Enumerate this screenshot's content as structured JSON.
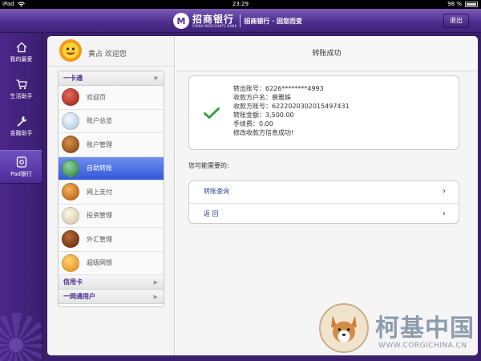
{
  "statusbar": {
    "device": "iPad",
    "time": "23:29",
    "battery": "98 %"
  },
  "header": {
    "logo_mark": "M",
    "brand_cn": "招商银行",
    "brand_en": "CHINA MERCHANTS BANK",
    "slogan": "招商银行 · 因您而变",
    "exit_label": "退出"
  },
  "leftnav": {
    "items": [
      {
        "label": "我的最爱",
        "icon": "home-icon"
      },
      {
        "label": "生活助手",
        "icon": "cart-icon"
      },
      {
        "label": "金融助手",
        "icon": "wrench-icon"
      },
      {
        "label": "Pad银行",
        "icon": "pad-icon",
        "active": true
      }
    ]
  },
  "user": {
    "welcome": "黄占  欢迎您"
  },
  "menu": {
    "group1": "一卡通",
    "items": [
      {
        "label": "欢迎页",
        "icon": "welcome-icon",
        "color": "#c0392b"
      },
      {
        "label": "账户总览",
        "icon": "account-overview-icon",
        "color": "#d7e6f5"
      },
      {
        "label": "账户管理",
        "icon": "account-manage-icon",
        "color": "#b5651d"
      },
      {
        "label": "自助转账",
        "icon": "transfer-icon",
        "color": "#3a9a5a",
        "active": true
      },
      {
        "label": "网上支付",
        "icon": "online-pay-icon",
        "color": "#d97a1e"
      },
      {
        "label": "投资管理",
        "icon": "investment-icon",
        "color": "#e8e1c8"
      },
      {
        "label": "外汇管理",
        "icon": "forex-icon",
        "color": "#8a4a1e"
      },
      {
        "label": "超级网银",
        "icon": "super-ebank-icon",
        "color": "#f0a020"
      }
    ],
    "group2": "信用卡",
    "group3": "一网通用户"
  },
  "main": {
    "title": "转账成功",
    "result_lines": [
      "转出账号：6226********4993",
      "收款方户名：裴雅姝",
      "收款方账号：6222020302015497431",
      "转账金额：3,500.00",
      "手续费：0.00",
      "修改收款方信息成功!"
    ],
    "suggest_label": "您可能需要的:",
    "actions": [
      {
        "label": "转账查询"
      },
      {
        "label": "返  回"
      }
    ]
  },
  "watermark": {
    "text": "柯基中国",
    "url": "WWW.CORGICHINA.CN"
  },
  "colors": {
    "brand_purple": "#4e2e8f",
    "active_blue": "#3358d8",
    "check_green": "#3aa04a"
  }
}
